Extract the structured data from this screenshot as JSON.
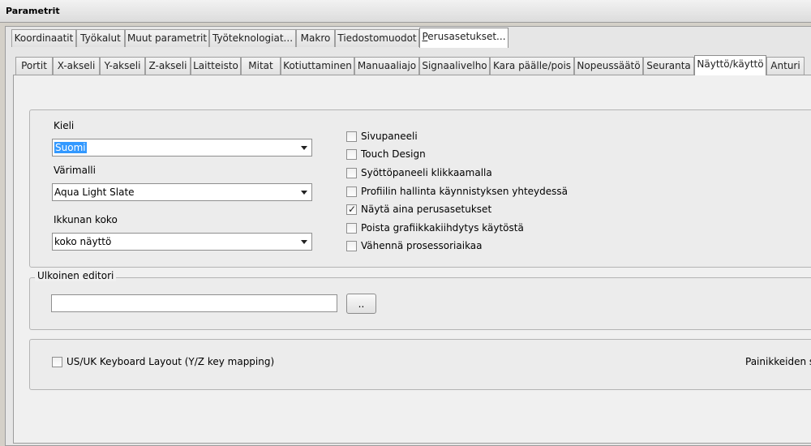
{
  "window": {
    "title": "Parametrit"
  },
  "main_tabs": [
    {
      "label": "Koordinaatit"
    },
    {
      "label": "Työkalut"
    },
    {
      "label": "Muut parametrit"
    },
    {
      "label": "Työteknologiat..."
    },
    {
      "label": "Makro"
    },
    {
      "label": "Tiedostomuodot"
    },
    {
      "label_first": "P",
      "label_rest": "erusasetukset...",
      "active": true
    }
  ],
  "sub_tabs": [
    {
      "label": "Portit"
    },
    {
      "label": "X-akseli"
    },
    {
      "label": "Y-akseli"
    },
    {
      "label": "Z-akseli"
    },
    {
      "label": "Laitteisto"
    },
    {
      "label": "Mitat"
    },
    {
      "label": "Kotiuttaminen"
    },
    {
      "label": "Manuaaliajo"
    },
    {
      "label": "Signaalivelho"
    },
    {
      "label": "Kara päälle/pois"
    },
    {
      "label": "Nopeussäätö"
    },
    {
      "label": "Seuranta"
    },
    {
      "label": "Näyttö/käyttö",
      "active": true
    },
    {
      "label": "Anturi"
    }
  ],
  "language": {
    "label": "Kieli",
    "value": "Suomi"
  },
  "color_model": {
    "label": "Värimalli",
    "value": "Aqua Light Slate"
  },
  "window_size": {
    "label": "Ikkunan koko",
    "value": "koko näyttö"
  },
  "options": [
    {
      "label": "Sivupaneeli",
      "checked": false
    },
    {
      "label": "Touch Design",
      "checked": false
    },
    {
      "label": "Syöttöpaneeli klikkaamalla",
      "checked": false
    },
    {
      "label": "Profiilin hallinta käynnistyksen yhteydessä",
      "checked": false
    },
    {
      "label": "Näytä aina perusasetukset",
      "checked": true
    },
    {
      "label": "Poista grafiikkakiihdytys käytöstä",
      "checked": false
    },
    {
      "label": "Vähennä prosessoriaikaa",
      "checked": false
    }
  ],
  "external_editor": {
    "legend": "Ulkoinen editori",
    "value": "",
    "browse_label": ".."
  },
  "keyboard": {
    "label": "US/UK Keyboard Layout (Y/Z key mapping)",
    "checked": false
  },
  "buttons_label": "Painikkeiden s",
  "check_mark": "✓"
}
